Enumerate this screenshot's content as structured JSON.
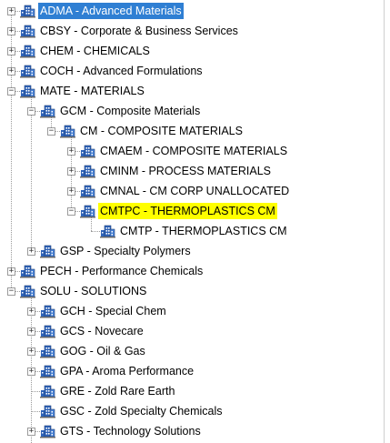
{
  "colors": {
    "selected_bg": "#2f7fd3",
    "selected_text": "#ffffff",
    "highlight_bg": "#ffff00",
    "icon_accent": "#2f63b8",
    "connector": "#9a9a9a"
  },
  "icons": {
    "node": "building-icon",
    "expander": "plus-minus-icon"
  },
  "tree": {
    "nodes": [
      {
        "label": "ADMA - Advanced Materials",
        "expanded": false,
        "selected": true
      },
      {
        "label": "CBSY - Corporate & Business Services",
        "expanded": false
      },
      {
        "label": "CHEM - CHEMICALS",
        "expanded": false
      },
      {
        "label": "COCH - Advanced Formulations",
        "expanded": false
      },
      {
        "label": "MATE - MATERIALS",
        "expanded": true
      },
      {
        "label": "GCM - Composite Materials",
        "expanded": true
      },
      {
        "label": "CM - COMPOSITE MATERIALS",
        "expanded": true
      },
      {
        "label": "CMAEM - COMPOSITE MATERIALS",
        "expanded": false
      },
      {
        "label": "CMINM - PROCESS MATERIALS",
        "expanded": false
      },
      {
        "label": "CMNAL - CM CORP UNALLOCATED",
        "expanded": false
      },
      {
        "label": "CMTPC - THERMOPLASTICS CM",
        "expanded": true,
        "highlighted": true
      },
      {
        "label": "CMTP - THERMOPLASTICS CM",
        "leaf": true
      },
      {
        "label": "GSP - Specialty Polymers",
        "expanded": false
      },
      {
        "label": "PECH - Performance Chemicals",
        "expanded": false
      },
      {
        "label": "SOLU - SOLUTIONS",
        "expanded": true
      },
      {
        "label": "GCH - Special Chem",
        "expanded": false
      },
      {
        "label": "GCS - Novecare",
        "expanded": false
      },
      {
        "label": "GOG - Oil & Gas",
        "expanded": false
      },
      {
        "label": "GPA - Aroma Performance",
        "expanded": false
      },
      {
        "label": "GRE - Zold Rare Earth",
        "leaf": true
      },
      {
        "label": "GSC - Zold Specialty Chemicals",
        "leaf": true
      },
      {
        "label": "GTS - Technology Solutions",
        "expanded": false
      }
    ]
  }
}
